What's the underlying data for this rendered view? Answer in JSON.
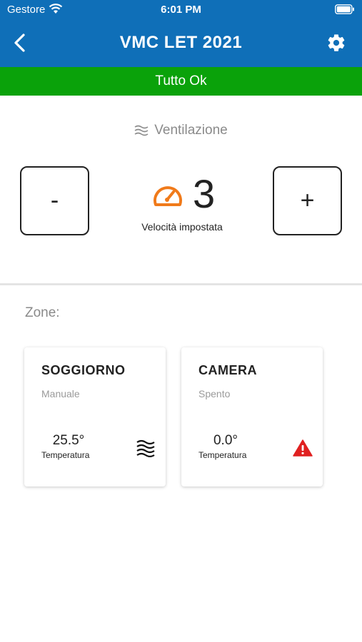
{
  "status_bar": {
    "carrier": "Gestore",
    "time": "6:01 PM",
    "icons": [
      "wifi-icon",
      "battery-icon"
    ]
  },
  "header": {
    "title": "VMC LET 2021",
    "icons": [
      "back-chevron-icon",
      "gear-icon"
    ],
    "color": "#0f6fb8"
  },
  "banner": {
    "text": "Tutto Ok",
    "color": "#0aa20a"
  },
  "ventilation": {
    "label": "Ventilazione",
    "icon": "airflow-waves-icon",
    "minus_label": "-",
    "plus_label": "+",
    "speed_value": "3",
    "speed_caption": "Velocità impostata",
    "speed_icon": "speedometer-icon",
    "speed_icon_color": "#f07a1a"
  },
  "zones": {
    "label": "Zone:",
    "items": [
      {
        "name": "SOGGIORNO",
        "mode": "Manuale",
        "temperature": "25.5°",
        "temperature_label": "Temperatura",
        "icon": "airflow-waves-icon"
      },
      {
        "name": "CAMERA",
        "mode": "Spento",
        "temperature": "0.0°",
        "temperature_label": "Temperatura",
        "icon": "warning-triangle-icon",
        "icon_color": "#e02020"
      }
    ]
  }
}
